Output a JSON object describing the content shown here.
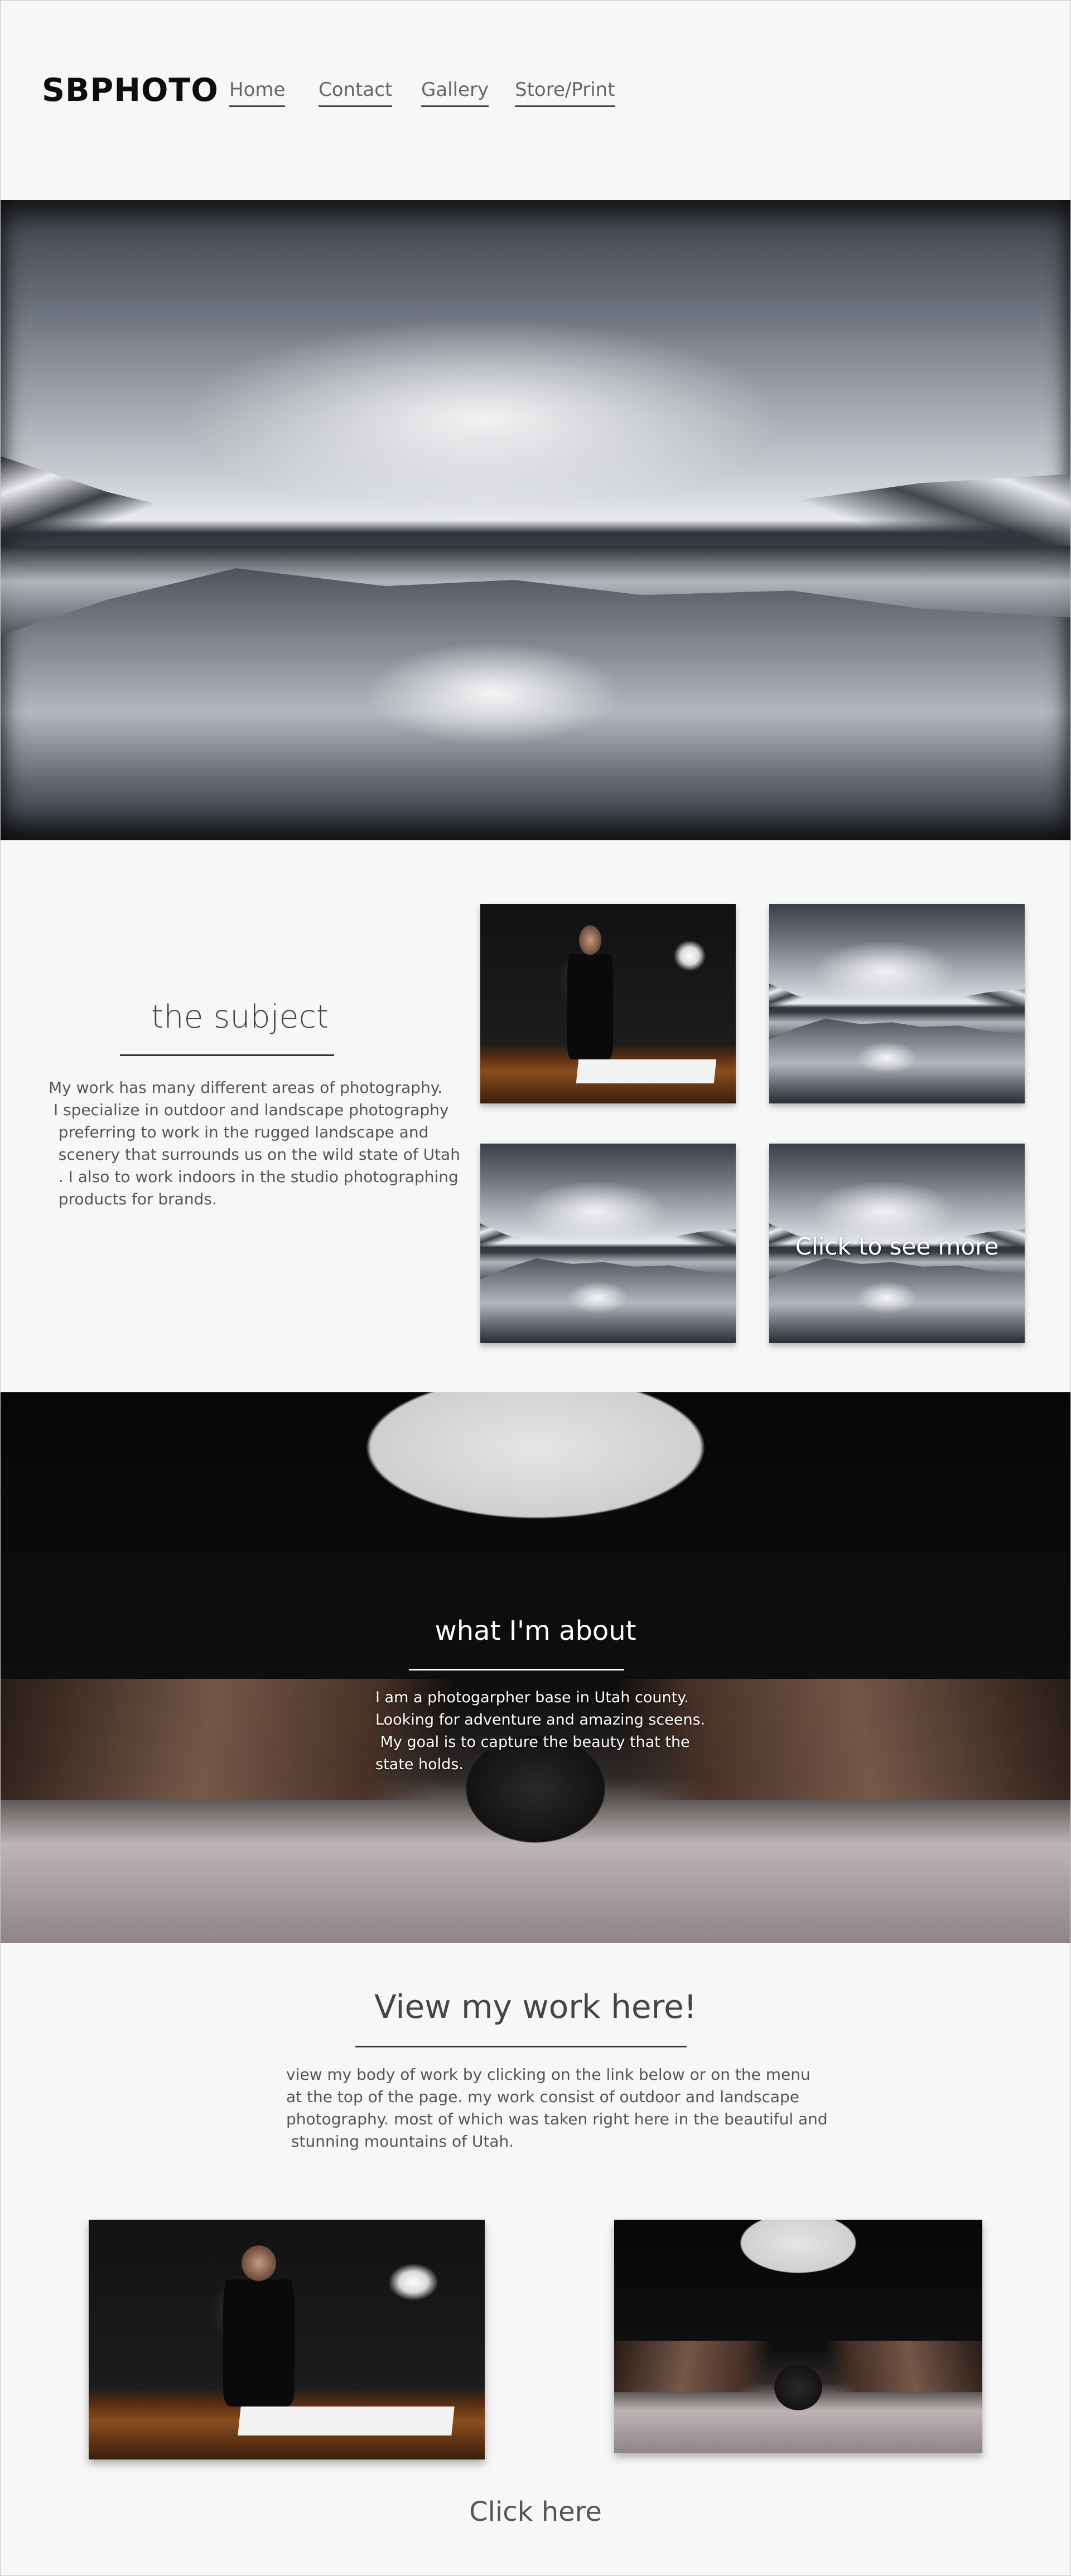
{
  "header": {
    "brand": "SBPHOTO",
    "nav": [
      "Home",
      "Contact",
      "Gallery",
      "Store/Print"
    ]
  },
  "subject": {
    "title": "the subject",
    "paragraph": "My work has many different areas of photography.\n I specialize in outdoor and landscape photography\n  preferring to work in the rugged landscape and\n  scenery that surrounds us on the wild state of Utah\n  . I also to work indoors in the studio photographing\n  products for brands.",
    "gallery_more_label": "Click to see more"
  },
  "about": {
    "title": "what I'm about",
    "paragraph": "I am a photogarpher base in Utah county.\nLooking for adventure and amazing sceens.\n My goal is to capture the beauty that the\nstate holds."
  },
  "work": {
    "title": "View my work here!",
    "paragraph": "view my body of work by clicking on the link below or on the menu\nat the top of the page. my work consist of outdoor and landscape\nphotography. most of which was taken right here in the beautiful and\n stunning mountains of Utah.",
    "cta": "Click here"
  },
  "colors": {
    "background": "#f7f7f7",
    "text": "#444444",
    "rule": "#333333"
  }
}
